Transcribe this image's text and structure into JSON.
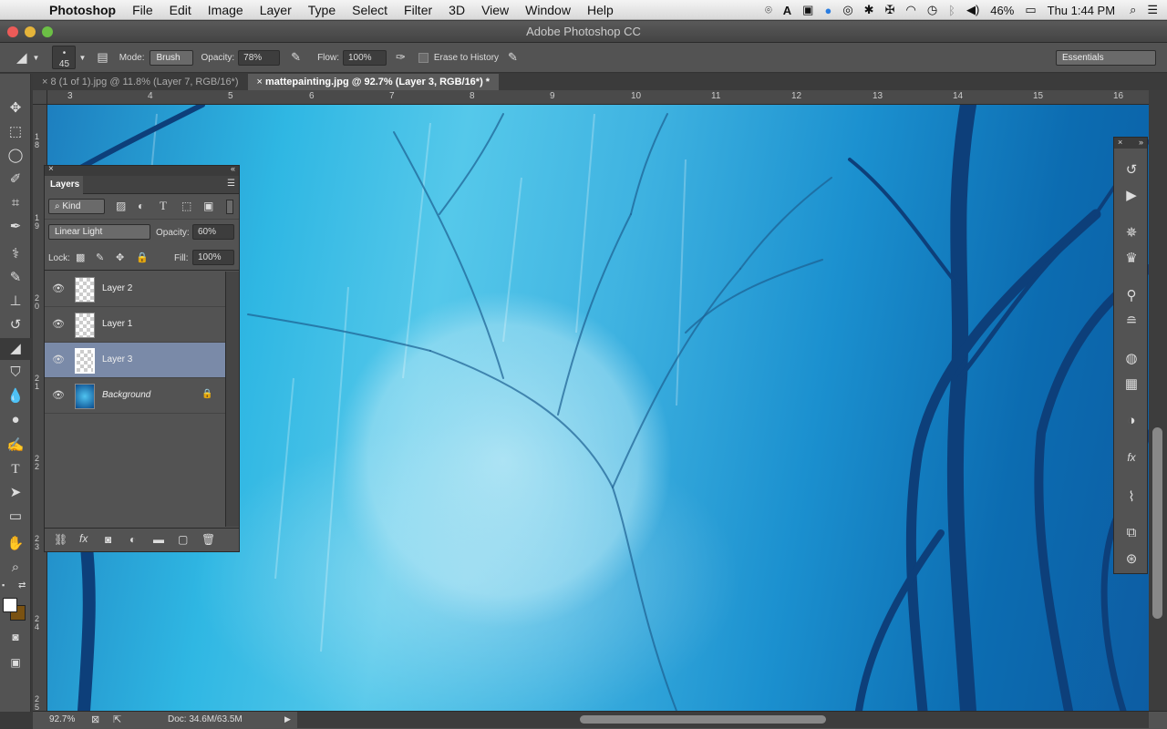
{
  "menubar": {
    "app_name": "Photoshop",
    "items": [
      "File",
      "Edit",
      "Image",
      "Layer",
      "Type",
      "Select",
      "Filter",
      "3D",
      "View",
      "Window",
      "Help"
    ],
    "status": {
      "battery": "46%",
      "clock": "Thu 1:44 PM"
    }
  },
  "window": {
    "title": "Adobe Photoshop CC"
  },
  "options_bar": {
    "brush_size": "45",
    "mode_label": "Mode:",
    "mode_value": "Brush",
    "opacity_label": "Opacity:",
    "opacity_value": "78%",
    "flow_label": "Flow:",
    "flow_value": "100%",
    "erase_to_history_label": "Erase to History",
    "workspace": "Essentials"
  },
  "document_tabs": [
    {
      "label": "8 (1 of 1).jpg @ 11.8% (Layer 7, RGB/16*)",
      "active": false
    },
    {
      "label": "mattepainting.jpg @ 92.7% (Layer 3, RGB/16*) *",
      "active": true
    }
  ],
  "rulers": {
    "horizontal": [
      "3",
      "4",
      "5",
      "6",
      "7",
      "8",
      "9",
      "10",
      "11",
      "12",
      "13",
      "14",
      "15",
      "16"
    ],
    "vertical": [
      "1\n8",
      "1\n9",
      "2\n0",
      "2\n1",
      "2\n2",
      "2\n3",
      "2\n4",
      "2\n5"
    ]
  },
  "layers_panel": {
    "title": "Layers",
    "filter_kind": "Kind",
    "blend_mode": "Linear Light",
    "opacity_label": "Opacity:",
    "opacity_value": "60%",
    "lock_label": "Lock:",
    "fill_label": "Fill:",
    "fill_value": "100%",
    "layers": [
      {
        "name": "Layer 2",
        "selected": false
      },
      {
        "name": "Layer 1",
        "selected": false
      },
      {
        "name": "Layer 3",
        "selected": true
      },
      {
        "name": "Background",
        "selected": false
      }
    ]
  },
  "status_bar": {
    "zoom": "92.7%",
    "doc_info": "Doc: 34.6M/63.5M"
  }
}
